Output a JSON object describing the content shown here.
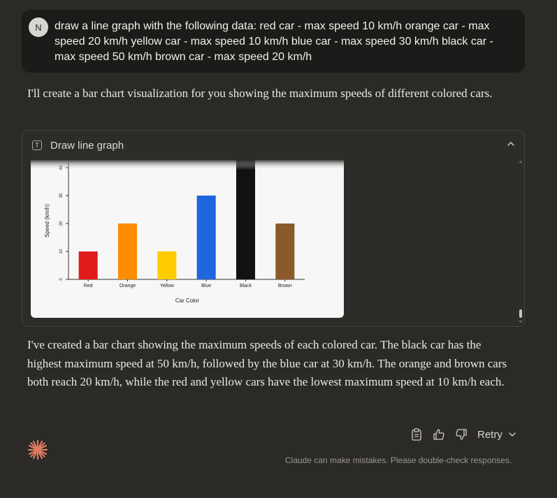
{
  "user": {
    "avatar_initial": "N",
    "message": "draw a line graph with the following data: red car - max speed 10 km/h orange car - max speed 20 km/h yellow car - max speed 10 km/h blue car - max speed 30 km/h black car - max speed 50 km/h brown car - max speed 20 km/h"
  },
  "assistant": {
    "intro": "I'll create a bar chart visualization for you showing the maximum speeds of different colored cars.",
    "summary": "I've created a bar chart showing the maximum speeds of each colored car. The black car has the highest maximum speed at 50 km/h, followed by the blue car at 30 km/h. The orange and brown cars both reach 20 km/h, while the red and yellow cars have the lowest maximum speed at 10 km/h each."
  },
  "artifact": {
    "icon_letter": "T",
    "title": "Draw line graph",
    "collapse_icon": "chevron-up-icon"
  },
  "chart_data": {
    "type": "bar",
    "categories": [
      "Red",
      "Orange",
      "Yellow",
      "Blue",
      "Black",
      "Brown"
    ],
    "values": [
      10,
      20,
      10,
      30,
      50,
      20
    ],
    "colors": [
      "#e01b1b",
      "#ff8c00",
      "#ffcc00",
      "#1f66dc",
      "#111111",
      "#8b5a2b"
    ],
    "title": "",
    "xlabel": "Car Color",
    "ylabel": "Speed (km/h)",
    "yticks": [
      0,
      10,
      20,
      30,
      40
    ],
    "ylim": [
      0,
      40
    ],
    "grid": false,
    "legend": "none"
  },
  "actions": {
    "copy_icon": "clipboard-icon",
    "like_icon": "thumbs-up-icon",
    "dislike_icon": "thumbs-down-icon",
    "retry_label": "Retry",
    "retry_icon": "chevron-down-icon"
  },
  "disclaimer": "Claude can make mistakes. Please double-check responses.",
  "colors": {
    "background": "#2b2a27",
    "user_bubble": "#1c1b19",
    "accent": "#e07a5f"
  }
}
